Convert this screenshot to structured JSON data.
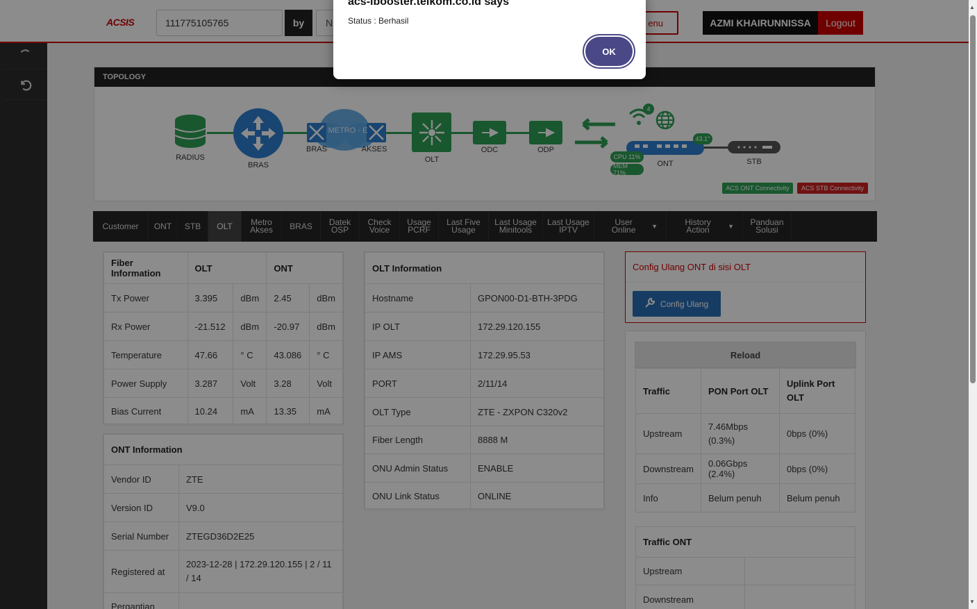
{
  "header": {
    "brand": "ACSIS",
    "search_value": "111775105765",
    "by_label": "by",
    "by_select": "N",
    "menu_label": "enu",
    "user_name": "AZMI KHAIRUNNISSA",
    "logout_label": "Logout"
  },
  "topology": {
    "title": "TOPOLOGY",
    "nodes": {
      "radius": "RADIUS",
      "bras": "BRAS",
      "bras2": "BRAS",
      "metro": "METRO - E",
      "akses": "AKSES",
      "olt": "OLT",
      "odc": "ODC",
      "odp": "ODP",
      "ont": "ONT",
      "stb": "STB"
    },
    "cpu": "CPU 11%",
    "mem": "MEM 71%",
    "temp": "43.1°",
    "wifi_count": "4",
    "acs_ont": "ACS ONT Connectivity",
    "acs_stb": "ACS STB Connectivity"
  },
  "tabs": [
    {
      "label": "Customer"
    },
    {
      "label": "ONT"
    },
    {
      "label": "STB"
    },
    {
      "label": "OLT"
    },
    {
      "label": "Metro Akses"
    },
    {
      "label": "BRAS"
    },
    {
      "label": "Datek OSP"
    },
    {
      "label": "Check Voice"
    },
    {
      "label": "Usage PCRF"
    },
    {
      "label": "Last Five Usage"
    },
    {
      "label": "Last Usage Minitools"
    },
    {
      "label": "Last Usage IPTV"
    },
    {
      "label": "User Online"
    },
    {
      "label": "History Action"
    },
    {
      "label": "Panduan Solusi"
    }
  ],
  "fiber": {
    "headers": [
      "Fiber Information",
      "OLT",
      "ONT"
    ],
    "rows": [
      [
        "Tx Power",
        "3.395",
        "dBm",
        "2.45",
        "dBm"
      ],
      [
        "Rx Power",
        "-21.512",
        "dBm",
        "-20.97",
        "dBm"
      ],
      [
        "Temperature",
        "47.66",
        "° C",
        "43.086",
        "° C"
      ],
      [
        "Power Supply",
        "3.287",
        "Volt",
        "3.28",
        "Volt"
      ],
      [
        "Bias Current",
        "10.24",
        "mA",
        "13.35",
        "mA"
      ]
    ]
  },
  "ont_info": {
    "title": "ONT Information",
    "rows": [
      [
        "Vendor ID",
        "ZTE"
      ],
      [
        "Version ID",
        "V9.0"
      ],
      [
        "Serial Number",
        "ZTEGD36D2E25"
      ],
      [
        "Registered at",
        "2023-12-28 | 172.29.120.155 | 2 / 11 / 14"
      ],
      [
        "Pergantian",
        ""
      ]
    ]
  },
  "olt_info": {
    "title": "OLT Information",
    "rows": [
      [
        "Hostname",
        "GPON00-D1-BTH-3PDG"
      ],
      [
        "IP OLT",
        "172.29.120.155"
      ],
      [
        "IP AMS",
        "172.29.95.53"
      ],
      [
        "PORT",
        "2/11/14"
      ],
      [
        "OLT Type",
        "ZTE - ZXPON C320v2"
      ],
      [
        "Fiber Length",
        "8888 M"
      ],
      [
        "ONU Admin Status",
        "ENABLE"
      ],
      [
        "ONU Link Status",
        "ONLINE"
      ]
    ]
  },
  "config": {
    "title": "Config Ulang ONT di sisi OLT",
    "button": "Config Ulang"
  },
  "traffic": {
    "reload": "Reload",
    "headers": [
      "Traffic",
      "PON Port OLT",
      "Uplink Port OLT"
    ],
    "rows": [
      [
        "Upstream",
        "7.46Mbps (0.3%)",
        "0bps (0%)"
      ],
      [
        "Downstream",
        "0.06Gbps (2.4%)",
        "0bps (0%)"
      ],
      [
        "Info",
        "Belum penuh",
        "Belum penuh"
      ]
    ]
  },
  "traffic_ont": {
    "title": "Traffic ONT",
    "rows": [
      [
        "Upstream",
        ""
      ],
      [
        "Downstream",
        ""
      ]
    ]
  },
  "dialog": {
    "title": "acs-ibooster.telkom.co.id says",
    "message": "Status : Berhasil",
    "ok": "OK"
  },
  "colors": {
    "brand_red": "#cc0000",
    "topology_green": "#2e9e55",
    "node_blue": "#2f7fcf",
    "dialog_ok": "#4a4886"
  }
}
